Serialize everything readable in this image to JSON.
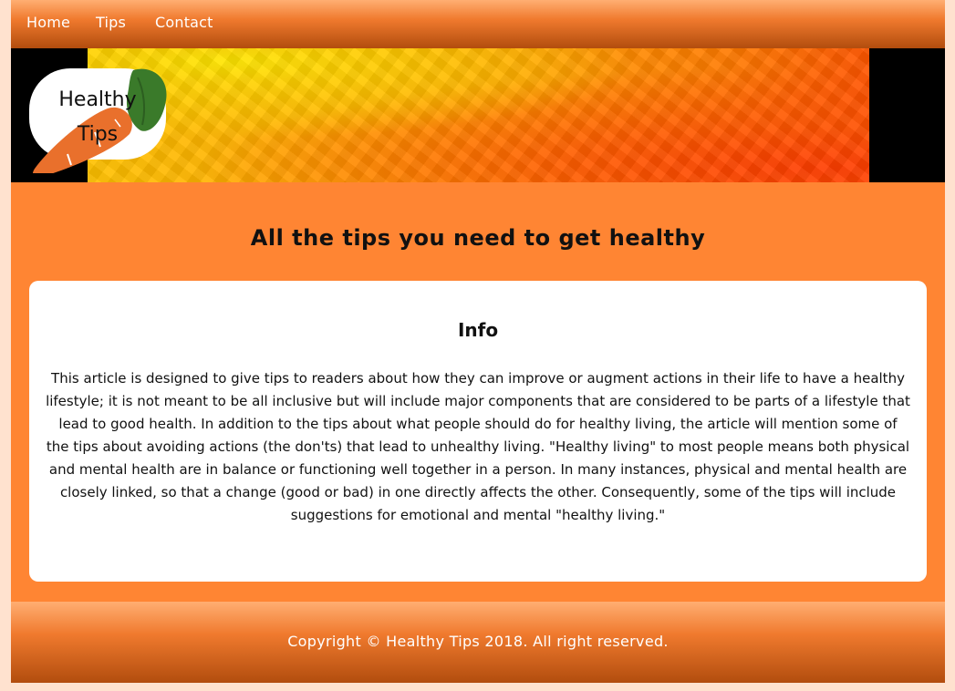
{
  "nav": {
    "items": [
      {
        "label": "Home"
      },
      {
        "label": "Tips"
      },
      {
        "label": "Contact"
      }
    ]
  },
  "banner": {
    "logo_text": "Healthy\nTips",
    "logo_icon": "carrot-icon"
  },
  "main": {
    "headline": "All the tips you need to get healthy",
    "info": {
      "title": "Info",
      "body": "This article is designed to give tips to readers about how they can improve or augment actions in their life to have a healthy lifestyle; it is not meant to be all inclusive but will include major components that are considered to be parts of a lifestyle that lead to good health. In addition to the tips about what people should do for healthy living, the article will mention some of the tips about avoiding actions (the don'ts) that lead to unhealthy living. \"Healthy living\" to most people means both physical and mental health are in balance or functioning well together in a person. In many instances, physical and mental health are closely linked, so that a change (good or bad) in one directly affects the other. Consequently, some of the tips will include suggestions for emotional and mental \"healthy living.\""
    }
  },
  "footer": {
    "copyright": "Copyright © Healthy Tips 2018. All right reserved."
  },
  "colors": {
    "page_bg": "#ffe2cf",
    "accent": "#ff8533",
    "nav_dark": "#b24d0e",
    "card": "#ffffff"
  }
}
